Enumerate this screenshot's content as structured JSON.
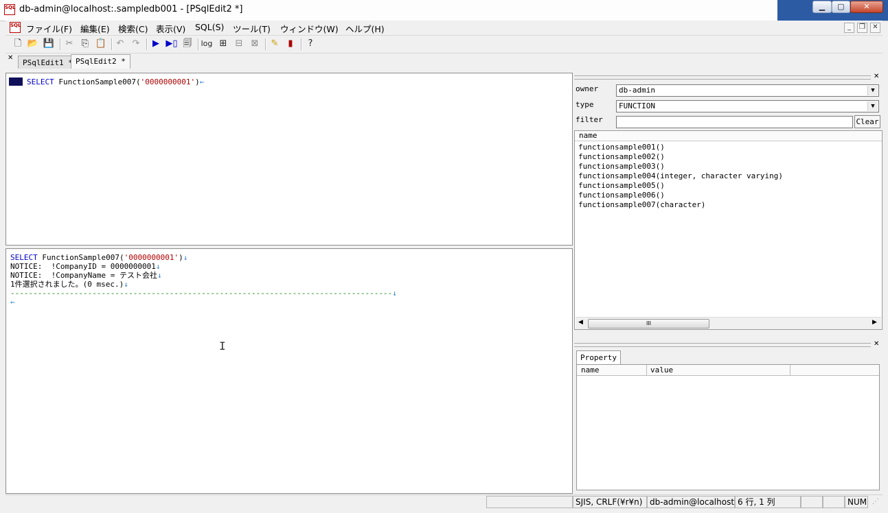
{
  "window": {
    "title": "db-admin@localhost:.sampledb001 - [PSqlEdit2 *]",
    "app_icon_text": "SQL"
  },
  "menu": [
    "ファイル(F)",
    "編集(E)",
    "検索(C)",
    "表示(V)",
    "SQL(S)",
    "ツール(T)",
    "ウィンドウ(W)",
    "ヘルプ(H)"
  ],
  "toolbar": {
    "log_label": "log"
  },
  "tabs": [
    "PSqlEdit1 *",
    "PSqlEdit2 *"
  ],
  "editor": {
    "line1_kw": "SELECT",
    "line1_fn": " FunctionSample007(",
    "line1_str": "'0000000001'",
    "line1_end": ")",
    "eol": "←"
  },
  "result": {
    "line1_kw": "SELECT",
    "line1_fn": " FunctionSample007(",
    "line1_str": "'0000000001'",
    "line1_end": ")",
    "line2": "NOTICE:  !CompanyID = 0000000001",
    "line3": "NOTICE:  !CompanyName = テスト会社",
    "line4": "1件選択されました。(0 msec.)",
    "separator": "------------------------------------------------------------------------------------",
    "newline_mark": "↓",
    "eol": "←"
  },
  "object_browser": {
    "owner_label": "owner",
    "owner_value": "db-admin",
    "type_label": "type",
    "type_value": "FUNCTION",
    "filter_label": "filter",
    "filter_value": "",
    "clear_label": "Clear",
    "name_header": "name",
    "items": [
      "functionsample001()",
      "functionsample002()",
      "functionsample003()",
      "functionsample004(integer, character varying)",
      "functionsample005()",
      "functionsample006()",
      "functionsample007(character)"
    ],
    "scroll_grip": "III"
  },
  "property_panel": {
    "tab_label": "Property",
    "col_name": "name",
    "col_value": "value"
  },
  "statusbar": {
    "encoding": "SJIS, CRLF(¥r¥n)",
    "connection": "db-admin@localhost:",
    "position": "6 行, 1 列",
    "num": "NUM"
  }
}
